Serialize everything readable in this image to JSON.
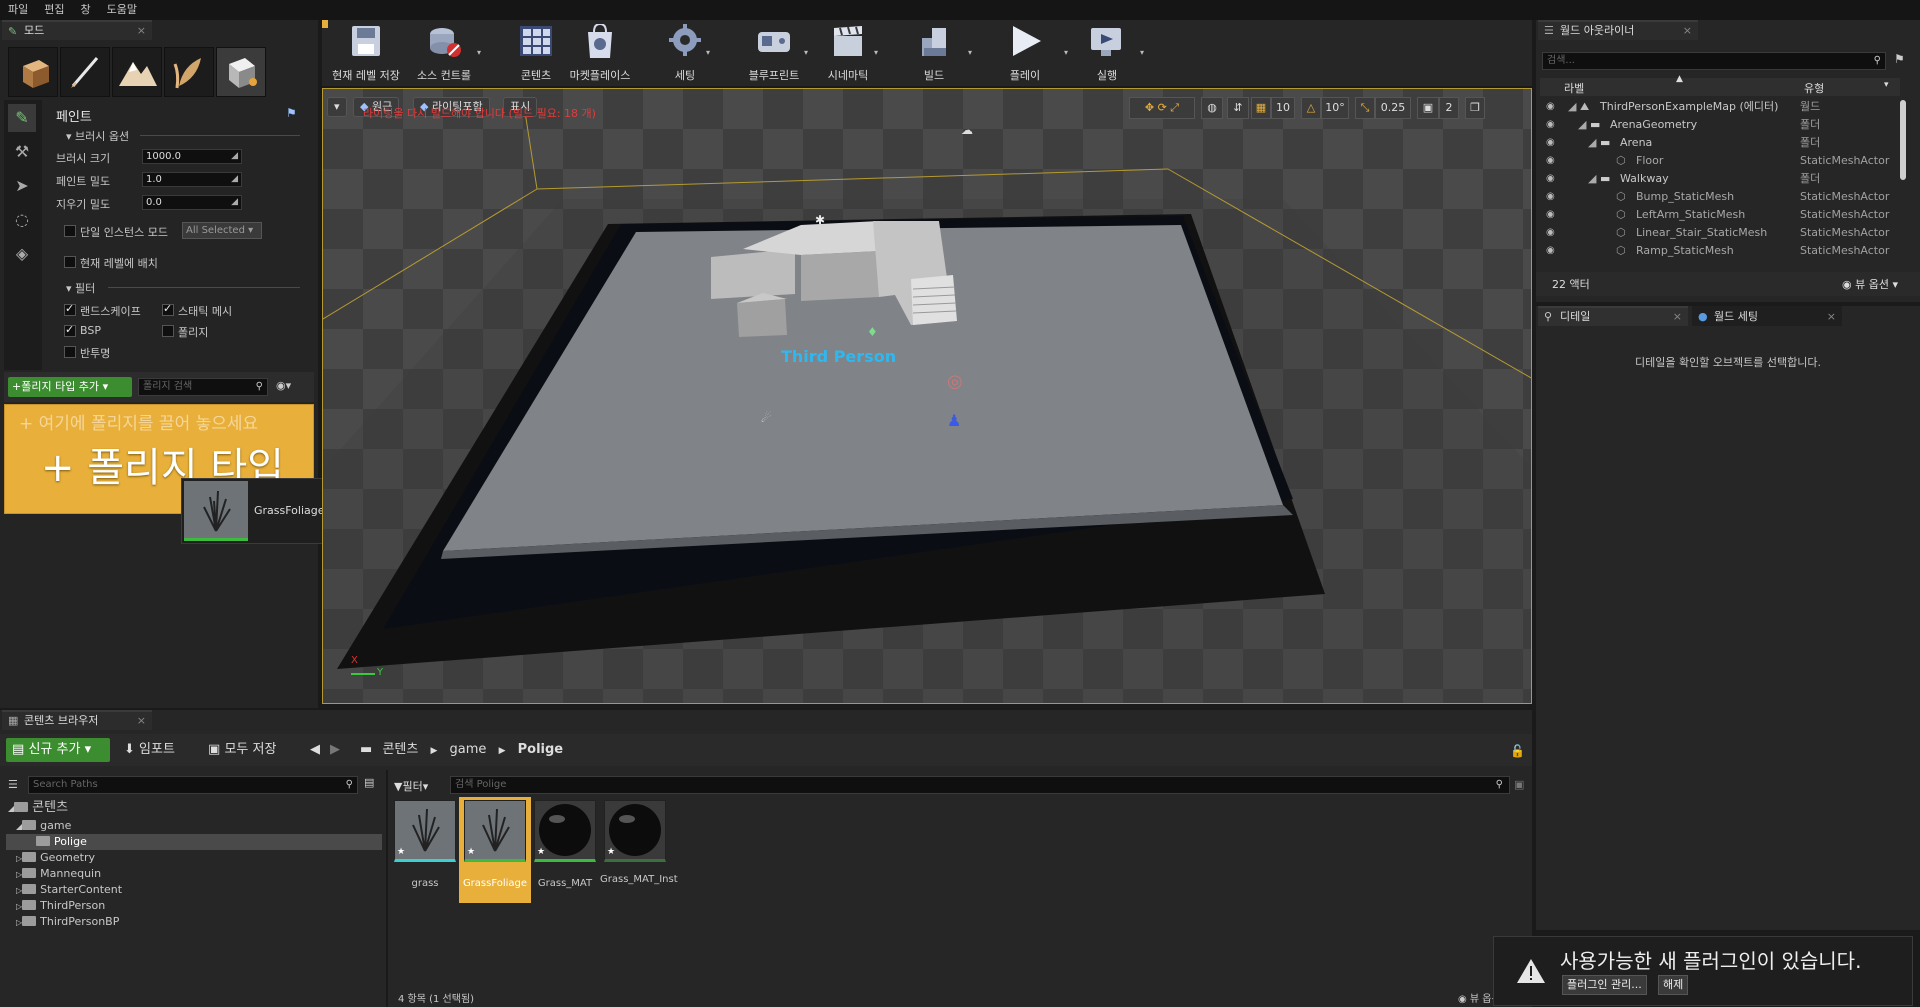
{
  "menu": [
    "파일",
    "편집",
    "창",
    "도움말"
  ],
  "modes_panel": {
    "tab": "모드",
    "section_title": "페인트",
    "brush_options_header": "브러시 옵션",
    "brush_size_label": "브러시 크기",
    "brush_size_value": "1000.0",
    "paint_density_label": "페인트 밀도",
    "paint_density_value": "1.0",
    "erase_density_label": "지우기 밀도",
    "erase_density_value": "0.0",
    "single_instance_label": "단일 인스턴스 모드",
    "single_instance_dropdown": "All Selected",
    "place_in_level_label": "현재 레벨에 배치",
    "filter_header": "필터",
    "filters": [
      {
        "label": "랜드스케이프",
        "checked": true
      },
      {
        "label": "스태틱 메시",
        "checked": true
      },
      {
        "label": "BSP",
        "checked": true
      },
      {
        "label": "폴리지",
        "checked": false
      },
      {
        "label": "반투명",
        "checked": false
      }
    ],
    "add_foliage_button": "폴리지 타입 추가",
    "search_placeholder": "폴리지 검색",
    "drop_hint": "+ 여기에 폴리지를 끌어 놓으세요",
    "drop_big_label": "+ 폴리지 타입",
    "drag_tooltip": "GrassFoliage"
  },
  "toolbar": [
    {
      "label": "현재 레벨 저장",
      "icon": "save-icon"
    },
    {
      "label": "소스 컨트롤",
      "icon": "source-control-icon"
    },
    {
      "label": "콘텐츠",
      "icon": "content-icon"
    },
    {
      "label": "마켓플레이스",
      "icon": "marketplace-icon"
    },
    {
      "label": "세팅",
      "icon": "settings-icon"
    },
    {
      "label": "블루프린트",
      "icon": "blueprint-icon"
    },
    {
      "label": "시네마틱",
      "icon": "cinematic-icon"
    },
    {
      "label": "빌드",
      "icon": "build-icon"
    },
    {
      "label": "플레이",
      "icon": "play-icon"
    },
    {
      "label": "실행",
      "icon": "launch-icon"
    }
  ],
  "viewport": {
    "perspective_button": "원근",
    "lit_button": "라이팅포함",
    "show_button": "표시",
    "warning": "라이팅을 다시 빌드해야 합니다 (빌드 필요: 18 개)",
    "grid_snap": "10",
    "rot_snap": "10°",
    "scale_snap": "0.25",
    "camera_speed": "2",
    "label_third_person": "Third Person",
    "axis_x": "X",
    "axis_y": "Y"
  },
  "outliner": {
    "tab": "월드 아웃라이너",
    "search_placeholder": "검색...",
    "col_label": "라벨",
    "col_type": "유형",
    "rows": [
      {
        "label": "ThirdPersonExampleMap (에디터)",
        "type": "월드"
      },
      {
        "label": "ArenaGeometry",
        "type": "폴더"
      },
      {
        "label": "Arena",
        "type": "폴더"
      },
      {
        "label": "Floor",
        "type": "StaticMeshActor"
      },
      {
        "label": "Walkway",
        "type": "폴더"
      },
      {
        "label": "Bump_StaticMesh",
        "type": "StaticMeshActor"
      },
      {
        "label": "LeftArm_StaticMesh",
        "type": "StaticMeshActor"
      },
      {
        "label": "Linear_Stair_StaticMesh",
        "type": "StaticMeshActor"
      },
      {
        "label": "Ramp_StaticMesh",
        "type": "StaticMeshActor"
      }
    ],
    "actor_count": "22 액터",
    "view_options": "뷰 옵션"
  },
  "details": {
    "tab_details": "디테일",
    "tab_world_settings": "월드 세팅",
    "empty_message": "디테일을 확인할 오브젝트를 선택합니다."
  },
  "content_browser": {
    "tab": "콘텐츠 브라우저",
    "add_new": "신규 추가",
    "import": "임포트",
    "save_all": "모두 저장",
    "path": [
      "콘텐츠",
      "game",
      "Polige"
    ],
    "search_paths_placeholder": "Search Paths",
    "filter_button": "필터",
    "search_assets_placeholder": "검색 Polige",
    "tree": [
      {
        "label": "콘텐츠",
        "level": 0
      },
      {
        "label": "game",
        "level": 1
      },
      {
        "label": "Polige",
        "level": 2
      },
      {
        "label": "Geometry",
        "level": 1
      },
      {
        "label": "Mannequin",
        "level": 1
      },
      {
        "label": "StarterContent",
        "level": 1
      },
      {
        "label": "ThirdPerson",
        "level": 1
      },
      {
        "label": "ThirdPersonBP",
        "level": 1
      }
    ],
    "assets": [
      {
        "label": "grass",
        "kind": "grass"
      },
      {
        "label": "GrassFoliage",
        "kind": "grass",
        "selected": true
      },
      {
        "label": "Grass_MAT",
        "kind": "sphere"
      },
      {
        "label": "Grass_MAT_Inst",
        "kind": "sphere"
      }
    ],
    "status": "4 항목 (1 선택됨)",
    "view_options": "뷰 옵션"
  },
  "notification": {
    "message": "사용가능한 새 플러그인이 있습니다.",
    "manage_button": "플러그인 관리...",
    "dismiss_button": "해제"
  },
  "colors": {
    "accent_orange": "#e8b03a",
    "selection_yellow": "#b59a33",
    "green_button": "#3c8d2f",
    "warning_red": "#d23030"
  }
}
